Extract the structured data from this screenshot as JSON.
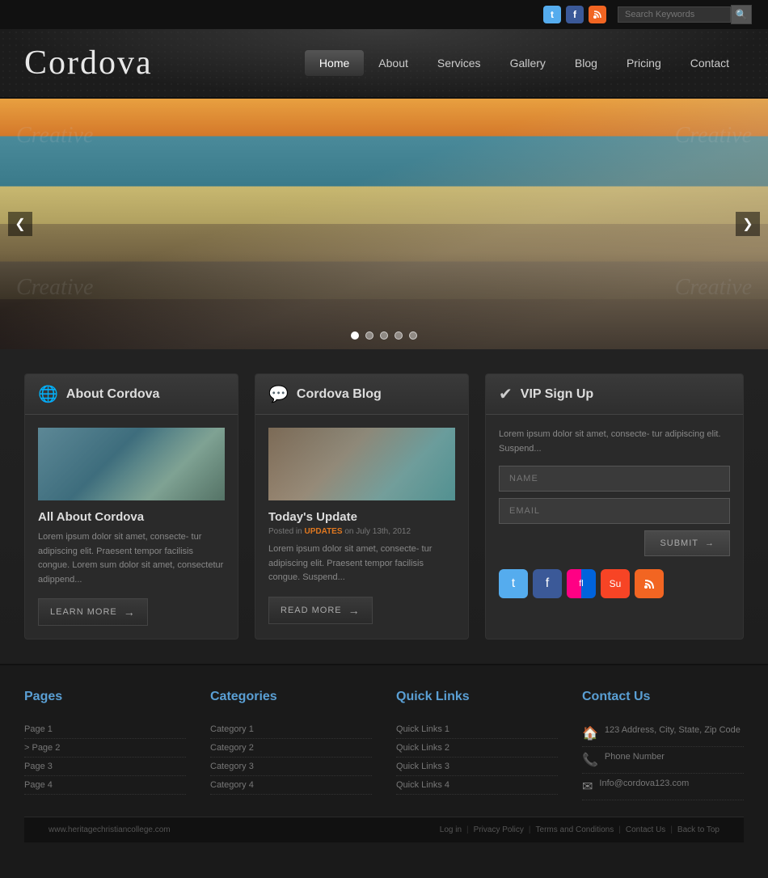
{
  "topbar": {
    "search_placeholder": "Search Keywords",
    "search_button": "🔍"
  },
  "header": {
    "logo": "Cordova",
    "nav": [
      {
        "label": "Home",
        "active": true
      },
      {
        "label": "About",
        "active": false
      },
      {
        "label": "Services",
        "active": false
      },
      {
        "label": "Gallery",
        "active": false
      },
      {
        "label": "Blog",
        "active": false
      },
      {
        "label": "Pricing",
        "active": false
      },
      {
        "label": "Contact",
        "active": false
      }
    ]
  },
  "slider": {
    "dots": 5,
    "active_dot": 0,
    "arrow_left": "❮",
    "arrow_right": "❯"
  },
  "about_panel": {
    "title": "About Cordova",
    "icon": "🌐",
    "article_title": "All About Cordova",
    "text": "Lorem ipsum dolor sit amet, consecte- tur adipiscing elit. Praesent tempor facilisis congue. Lorem sum dolor sit amet, consectetur adippend...",
    "button_label": "LEARN MORE"
  },
  "blog_panel": {
    "title": "Cordova Blog",
    "icon": "💬",
    "article_title": "Today's Update",
    "meta_prefix": "Posted in",
    "meta_tag": "UPDATES",
    "meta_suffix": "on July 13th, 2012",
    "text": "Lorem ipsum dolor sit amet, consecte- tur adipiscing elit. Praesent tempor facilisis congue. Suspend...",
    "button_label": "READ MORE"
  },
  "vip_panel": {
    "title": "VIP Sign Up",
    "icon": "✔",
    "desc": "Lorem ipsum dolor sit amet, consecte- tur adipiscing elit. Suspend...",
    "name_placeholder": "NAME",
    "email_placeholder": "EMAIL",
    "submit_label": "SUBMIT"
  },
  "footer": {
    "pages_title": "Pages",
    "pages": [
      {
        "label": "Page 1"
      },
      {
        "label": ">  Page 2"
      },
      {
        "label": "Page 3"
      },
      {
        "label": "Page 4"
      }
    ],
    "categories_title": "Categories",
    "categories": [
      {
        "label": "Category 1"
      },
      {
        "label": "Category 2"
      },
      {
        "label": "Category 3"
      },
      {
        "label": "Category 4"
      }
    ],
    "quicklinks_title": "Quick Links",
    "quicklinks": [
      {
        "label": "Quick Links 1"
      },
      {
        "label": "Quick Links 2"
      },
      {
        "label": "Quick Links 3"
      },
      {
        "label": "Quick Links 4"
      }
    ],
    "contact_title": "Contact Us",
    "contact_address": "123 Address, City, State, Zip Code",
    "contact_phone": "Phone Number",
    "contact_email": "Info@cordova123.com",
    "bottom_url": "www.heritagechristiancollege.com",
    "bottom_links": [
      "Log in",
      "Privacy Policy",
      "Terms and Conditions",
      "Contact Us",
      "Back to Top"
    ]
  }
}
